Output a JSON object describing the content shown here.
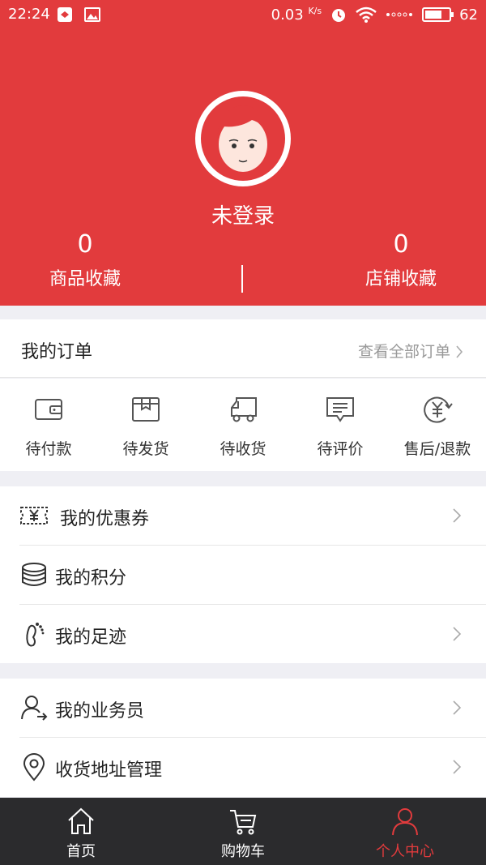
{
  "status_bar": {
    "time": "22:24",
    "speed": "0.03",
    "speed_unit": "K/s",
    "battery": "62"
  },
  "profile": {
    "login_status": "未登录",
    "goods_fav_count": "0",
    "goods_fav_label": "商品收藏",
    "shop_fav_count": "0",
    "shop_fav_label": "店铺收藏"
  },
  "orders": {
    "title": "我的订单",
    "view_all": "查看全部订单",
    "items": [
      {
        "label": "待付款",
        "icon": "wallet-icon"
      },
      {
        "label": "待发货",
        "icon": "box-icon"
      },
      {
        "label": "待收货",
        "icon": "truck-icon"
      },
      {
        "label": "待评价",
        "icon": "comment-icon"
      },
      {
        "label": "售后/退款",
        "icon": "refund-icon"
      }
    ]
  },
  "menu1": [
    {
      "label": "我的优惠券",
      "icon": "coupon-icon"
    },
    {
      "label": "我的积分",
      "icon": "coins-icon"
    },
    {
      "label": "我的足迹",
      "icon": "footprint-icon"
    }
  ],
  "menu2": [
    {
      "label": "我的业务员",
      "icon": "salesperson-icon"
    },
    {
      "label": "收货地址管理",
      "icon": "location-icon"
    }
  ],
  "tabs": [
    {
      "label": "首页",
      "icon": "home-icon"
    },
    {
      "label": "购物车",
      "icon": "cart-icon"
    },
    {
      "label": "个人中心",
      "icon": "person-icon",
      "active": true
    }
  ],
  "colors": {
    "brand": "#e23b3d",
    "tabbar": "#2b2b2d"
  }
}
